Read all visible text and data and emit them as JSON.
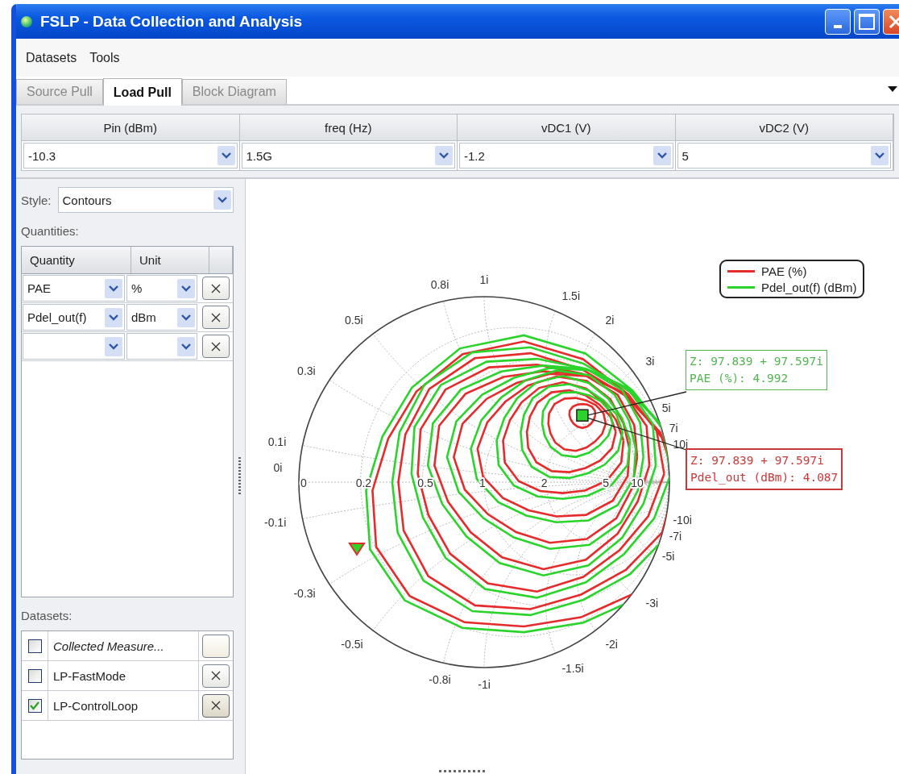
{
  "window": {
    "title": "FSLP - Data Collection and Analysis"
  },
  "menu": [
    "Datasets",
    "Tools"
  ],
  "tabs": [
    {
      "label": "Source Pull",
      "selected": false
    },
    {
      "label": "Load Pull",
      "selected": true
    },
    {
      "label": "Block Diagram",
      "selected": false
    }
  ],
  "parameters": [
    {
      "name": "Pin (dBm)",
      "value": "-10.3"
    },
    {
      "name": "freq (Hz)",
      "value": "1.5G"
    },
    {
      "name": "vDC1 (V)",
      "value": "-1.2"
    },
    {
      "name": "vDC2 (V)",
      "value": "5"
    }
  ],
  "style": {
    "label": "Style:",
    "value": "Contours"
  },
  "quantities": {
    "label": "Quantities:",
    "columns": [
      "Quantity",
      "Unit"
    ],
    "rows": [
      {
        "kind": "entry",
        "quantity": "PAE",
        "unit": "%"
      },
      {
        "kind": "entry",
        "quantity": "Pdel_out(f)",
        "unit": "dBm"
      },
      {
        "kind": "blank"
      }
    ]
  },
  "datasets": {
    "label": "Datasets:",
    "rows": [
      {
        "kind": "collected",
        "name": "Collected Measure...",
        "checked": false
      },
      {
        "kind": "removable",
        "name": "LP-FastMode",
        "checked": false
      },
      {
        "kind": "removable",
        "name": "LP-ControlLoop",
        "checked": true
      }
    ]
  },
  "chart": {
    "legend": [
      {
        "label": "PAE (%)",
        "color": "#e52b2b"
      },
      {
        "label": "Pdel_out(f) (dBm)",
        "color": "#2bd42b"
      }
    ],
    "resistance_labels": [
      "0",
      "0.2",
      "0.5",
      "1",
      "2",
      "5",
      "10"
    ],
    "reactance_labels_upper": [
      "0i",
      "0.1i",
      "0.3i",
      "0.5i",
      "0.8i",
      "1i",
      "1.5i",
      "2i",
      "3i",
      "5i",
      "7i",
      "10i"
    ],
    "reactance_labels_lower": [
      "-0.1i",
      "-0.3i",
      "-0.5i",
      "-0.8i",
      "-1i",
      "-1.5i",
      "-2i",
      "-3i",
      "-5i",
      "-7i",
      "-10i"
    ],
    "tooltips": [
      {
        "lines": [
          "Z: 97.839 + 97.597i",
          "PAE (%): 4.992"
        ],
        "color": "#52b552"
      },
      {
        "lines": [
          "Z: 97.839 + 97.597i",
          "Pdel_out (dBm): 4.087"
        ],
        "color": "#c83a3a"
      }
    ]
  }
}
